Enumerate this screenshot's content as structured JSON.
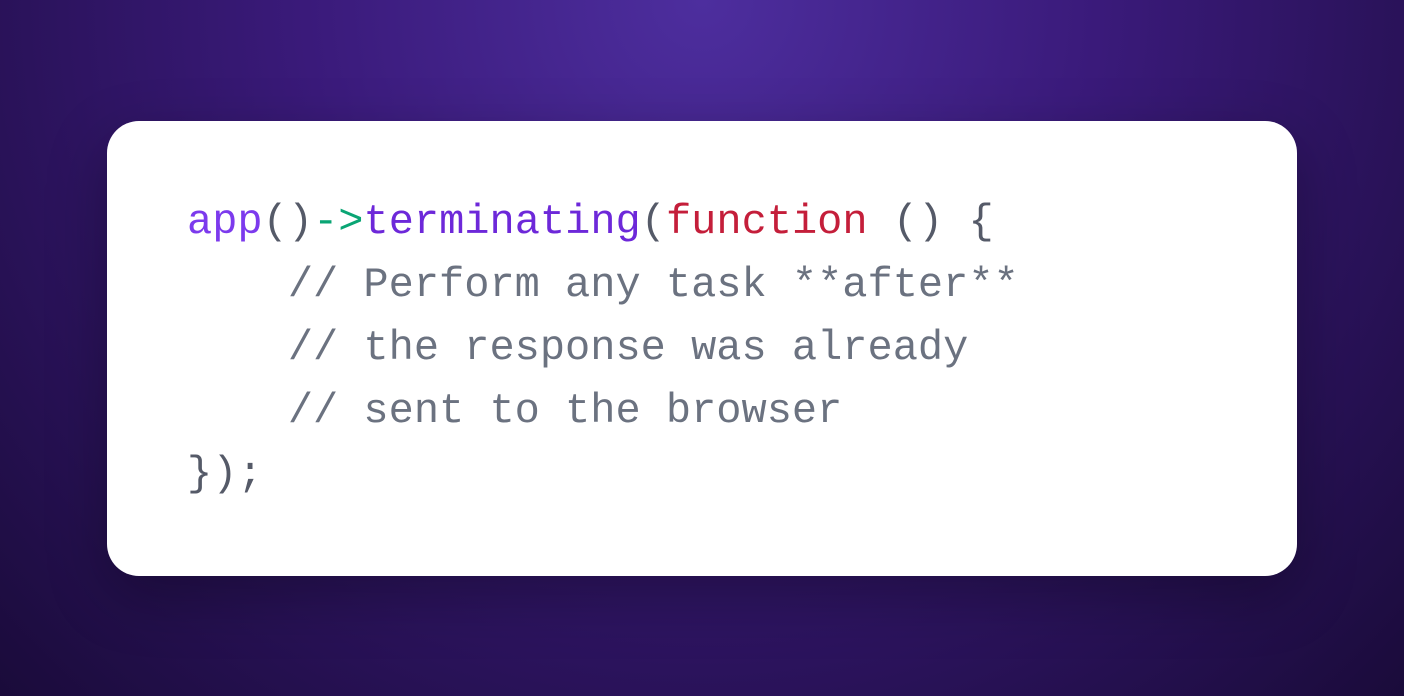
{
  "code": {
    "fn_app": "app",
    "open_paren1": "(",
    "close_paren1": ")",
    "arrow": "->",
    "method": "terminating",
    "open_paren2": "(",
    "keyword_function": "function",
    "space_after_function": " ",
    "anon_parens": "()",
    "space_before_brace": " ",
    "open_brace": "{",
    "comment_line1": "    // Perform any task **after**",
    "comment_line2": "    // the response was already",
    "comment_line3": "    // sent to the browser",
    "close_brace": "}",
    "close_paren_end": ")",
    "semicolon": ";"
  }
}
